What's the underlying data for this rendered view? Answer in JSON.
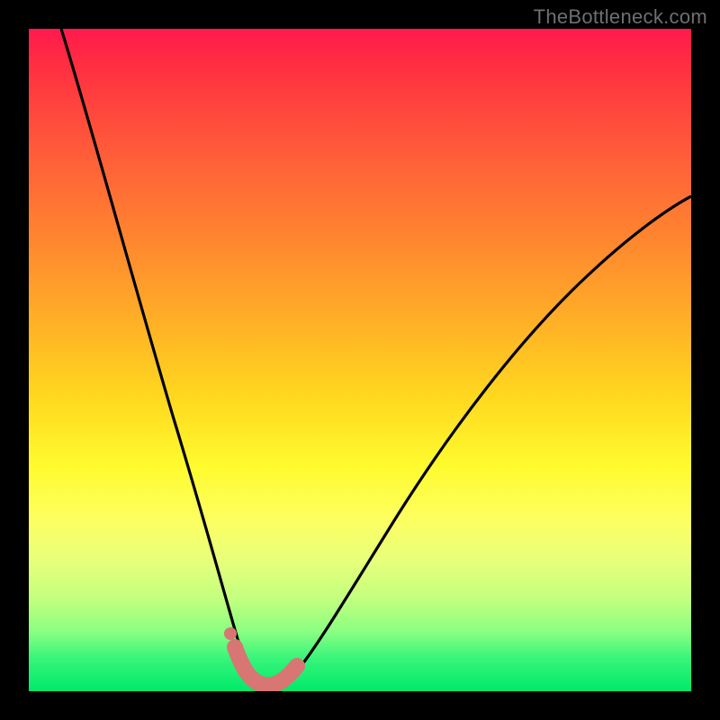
{
  "watermark": "TheBottleneck.com",
  "colors": {
    "frame": "#000000",
    "curve": "#000000",
    "marker": "#d77672",
    "gradient_top": "#ff1a4d",
    "gradient_mid": "#fffb2e",
    "gradient_bottom": "#00e96a"
  },
  "chart_data": {
    "type": "line",
    "title": "",
    "xlabel": "",
    "ylabel": "",
    "xlim": [
      0,
      100
    ],
    "ylim": [
      0,
      100
    ],
    "grid": false,
    "legend": false,
    "note": "No axis ticks or numeric labels are rendered in the image; values are estimated from geometry on a 0–100 normalized scale.",
    "series": [
      {
        "name": "bottleneck-curve",
        "x": [
          5,
          8,
          11,
          14,
          17,
          20,
          23,
          26,
          28,
          30,
          31.5,
          33,
          34.5,
          36,
          38,
          40,
          43,
          47,
          52,
          58,
          64,
          71,
          78,
          86,
          94,
          100
        ],
        "y": [
          100,
          88,
          77,
          66,
          56,
          46,
          36,
          26,
          18,
          11,
          6,
          3,
          1,
          0.5,
          1,
          3,
          7,
          13,
          20,
          28,
          36,
          44,
          52,
          60,
          67,
          72
        ]
      }
    ],
    "markers": [
      {
        "name": "valley-highlight",
        "shape": "rounded-band",
        "color": "#d77672",
        "x_range": [
          31,
          40
        ],
        "y": 1.5
      },
      {
        "name": "outlier-dot",
        "shape": "dot",
        "color": "#d77672",
        "x": 30.5,
        "y": 7
      }
    ]
  }
}
